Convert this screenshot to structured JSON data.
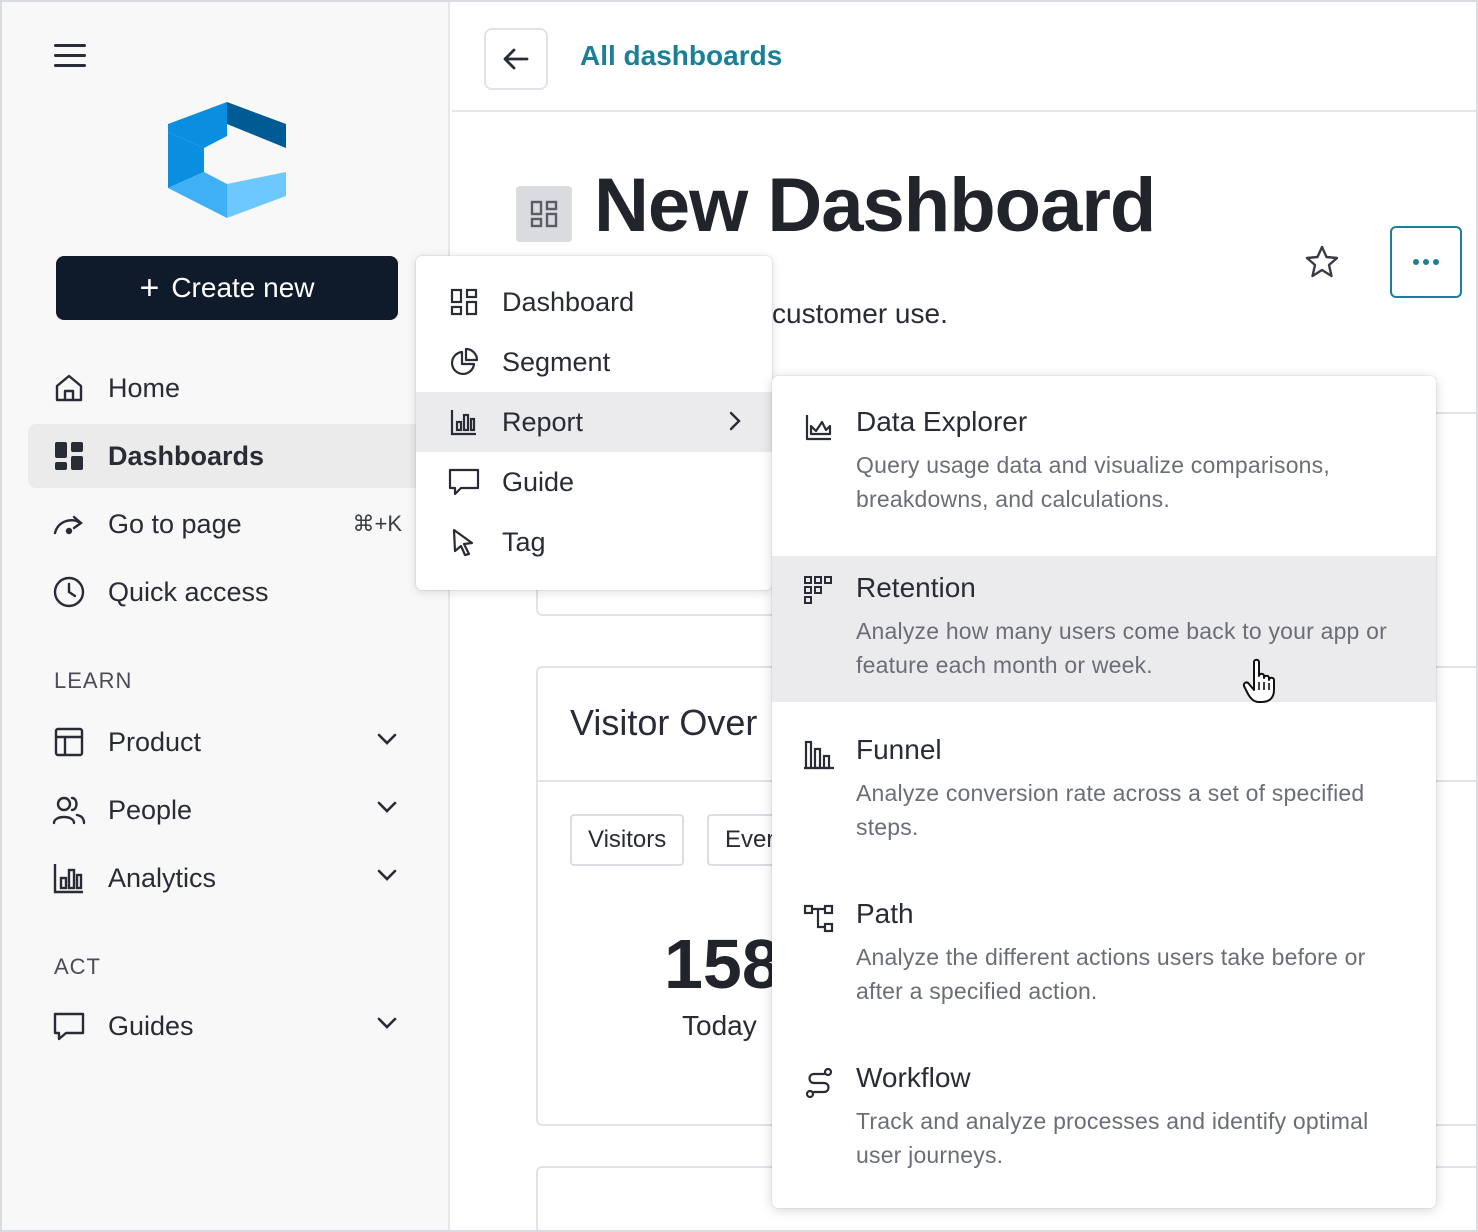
{
  "sidebar": {
    "create_new_label": "Create new",
    "nav": [
      {
        "label": "Home",
        "icon": "home-icon"
      },
      {
        "label": "Dashboards",
        "icon": "dashboards-icon",
        "active": true
      },
      {
        "label": "Go to page",
        "icon": "go-to-page-icon",
        "shortcut": "⌘+K"
      },
      {
        "label": "Quick access",
        "icon": "clock-icon"
      }
    ],
    "learn_label": "LEARN",
    "learn_items": [
      {
        "label": "Product",
        "icon": "product-icon"
      },
      {
        "label": "People",
        "icon": "people-icon"
      },
      {
        "label": "Analytics",
        "icon": "analytics-icon"
      }
    ],
    "act_label": "ACT",
    "act_items": [
      {
        "label": "Guides",
        "icon": "guides-icon"
      }
    ]
  },
  "topbar": {
    "breadcrumb": "All dashboards"
  },
  "dashboard": {
    "title": "New Dashboard",
    "description_visible": "customer use.",
    "card_title": "Visitor Over",
    "chips": [
      "Visitors",
      "Ever"
    ],
    "big_number": "158",
    "period_label": "Today"
  },
  "create_menu": {
    "items": [
      {
        "label": "Dashboard",
        "icon": "dashboard-icon"
      },
      {
        "label": "Segment",
        "icon": "segment-pie-icon"
      },
      {
        "label": "Report",
        "icon": "report-bar-icon",
        "active": true,
        "has_submenu": true
      },
      {
        "label": "Guide",
        "icon": "guide-chat-icon"
      },
      {
        "label": "Tag",
        "icon": "tag-cursor-icon"
      }
    ]
  },
  "report_menu": {
    "items": [
      {
        "title": "Data Explorer",
        "desc": "Query usage data and visualize comparisons, breakdowns, and calculations.",
        "icon": "data-explorer-icon"
      },
      {
        "title": "Retention",
        "desc": "Analyze how many users come back to your app or feature each month or week.",
        "icon": "retention-grid-icon",
        "active": true
      },
      {
        "title": "Funnel",
        "desc": "Analyze conversion rate across a set of specified steps.",
        "icon": "funnel-bars-icon"
      },
      {
        "title": "Path",
        "desc": "Analyze the different actions users take before or after a specified action.",
        "icon": "path-icon"
      },
      {
        "title": "Workflow",
        "desc": "Track and analyze processes and identify optimal user journeys.",
        "icon": "workflow-icon"
      }
    ]
  },
  "colors": {
    "accent": "#1b7f97",
    "create_button": "#0f1a2b",
    "logo_dark": "#005b94",
    "logo_mid": "#0a8fe0",
    "logo_light": "#6cc8ff"
  }
}
